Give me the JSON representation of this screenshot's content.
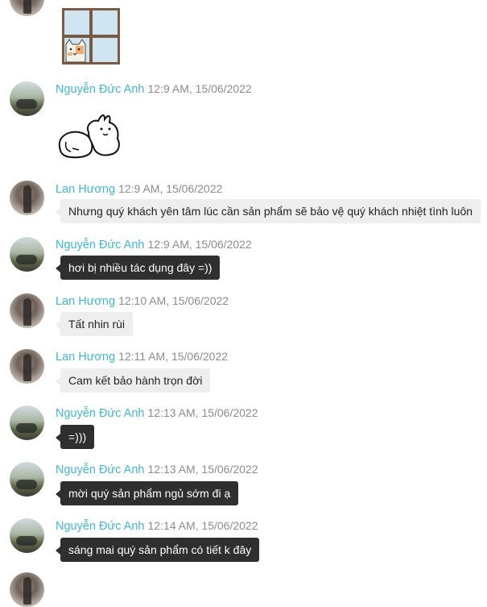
{
  "messages": [
    {
      "sender": "",
      "time": "",
      "type": "sticker",
      "sticker": "cat-window-sticker",
      "text": ""
    },
    {
      "sender": "Nguyễn Đức Anh",
      "time": "12:9 AM, 15/06/2022",
      "type": "sticker",
      "sticker": "rabbit-lying-sticker",
      "text": ""
    },
    {
      "sender": "Lan Hương",
      "time": "12:9 AM, 15/06/2022",
      "type": "text",
      "style": "light",
      "text": "Nhưng quý khách yên tâm lúc cần sản phẩm sẽ bảo vệ quý khách nhiệt tình luôn"
    },
    {
      "sender": "Nguyễn Đức Anh",
      "time": "12:9 AM, 15/06/2022",
      "type": "text",
      "style": "dark",
      "text": "hơi bị nhiều tác dụng đây =))"
    },
    {
      "sender": "Lan Hương",
      "time": "12:10 AM, 15/06/2022",
      "type": "text",
      "style": "light",
      "text": "Tất nhin rùi"
    },
    {
      "sender": "Lan Hương",
      "time": "12:11 AM, 15/06/2022",
      "type": "text",
      "style": "light",
      "text": "Cam kết bảo hành trọn đời"
    },
    {
      "sender": "Nguyễn Đức Anh",
      "time": "12:13 AM, 15/06/2022",
      "type": "text",
      "style": "dark",
      "text": "=)))"
    },
    {
      "sender": "Nguyễn Đức Anh",
      "time": "12:13 AM, 15/06/2022",
      "type": "text",
      "style": "dark",
      "text": "mời quý sản phẩm ngủ sớm đi ạ"
    },
    {
      "sender": "Nguyễn Đức Anh",
      "time": "12:14 AM, 15/06/2022",
      "type": "text",
      "style": "dark",
      "text": "sáng mai quý sản phẩm có tiết k đây"
    }
  ]
}
